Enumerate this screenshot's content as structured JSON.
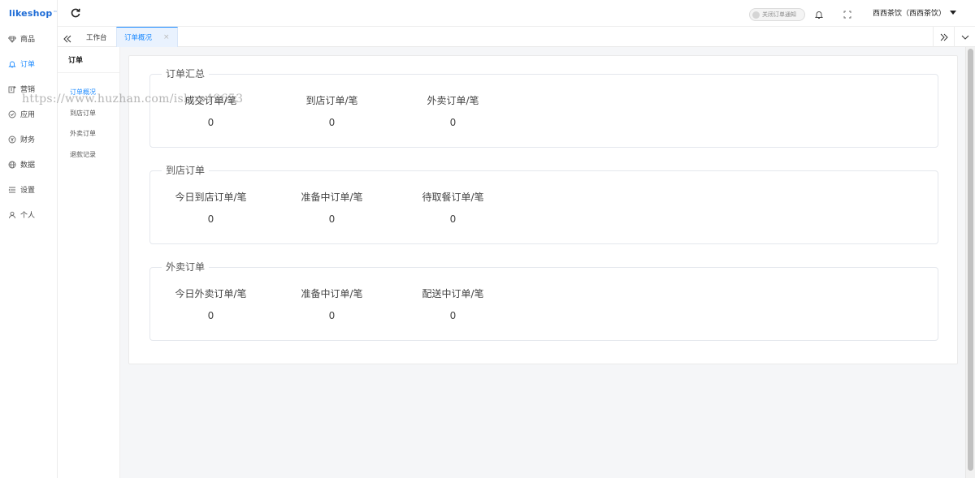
{
  "app": {
    "logo": "likeshop",
    "logo_tm": "™"
  },
  "sidebar": {
    "items": [
      {
        "label": "商品",
        "icon": "diamond-icon",
        "active": false
      },
      {
        "label": "订单",
        "icon": "bell-icon",
        "active": true
      },
      {
        "label": "营销",
        "icon": "marketing-icon",
        "active": false
      },
      {
        "label": "应用",
        "icon": "shield-check-icon",
        "active": false
      },
      {
        "label": "财务",
        "icon": "yen-icon",
        "active": false
      },
      {
        "label": "数据",
        "icon": "globe-icon",
        "active": false
      },
      {
        "label": "设置",
        "icon": "list-settings-icon",
        "active": false
      },
      {
        "label": "个人",
        "icon": "user-icon",
        "active": false
      }
    ]
  },
  "header": {
    "order_notify_toggle": "关闭订单通知",
    "user_name": "西西茶饮（西西茶饮）"
  },
  "tabs": {
    "items": [
      {
        "label": "工作台",
        "active": false
      },
      {
        "label": "订单概况",
        "active": true,
        "close": "×"
      }
    ]
  },
  "subnav": {
    "title": "订单",
    "items": [
      {
        "label": "订单概况",
        "active": true
      },
      {
        "label": "到店订单",
        "active": false
      },
      {
        "label": "外卖订单",
        "active": false
      },
      {
        "label": "退款记录",
        "active": false
      }
    ]
  },
  "groups": [
    {
      "title": "订单汇总",
      "stats": [
        {
          "label": "成交订单/笔",
          "value": "0"
        },
        {
          "label": "到店订单/笔",
          "value": "0"
        },
        {
          "label": "外卖订单/笔",
          "value": "0"
        }
      ]
    },
    {
      "title": "到店订单",
      "stats": [
        {
          "label": "今日到店订单/笔",
          "value": "0"
        },
        {
          "label": "准备中订单/笔",
          "value": "0"
        },
        {
          "label": "待取餐订单/笔",
          "value": "0"
        }
      ]
    },
    {
      "title": "外卖订单",
      "stats": [
        {
          "label": "今日外卖订单/笔",
          "value": "0"
        },
        {
          "label": "准备中订单/笔",
          "value": "0"
        },
        {
          "label": "配送中订单/笔",
          "value": "0"
        }
      ]
    }
  ],
  "watermark": "https://www.huzhan.com/ishop49653",
  "colors": {
    "accent": "#1e8bff",
    "logo": "#1e6cd6",
    "bg": "#f5f6f8"
  }
}
